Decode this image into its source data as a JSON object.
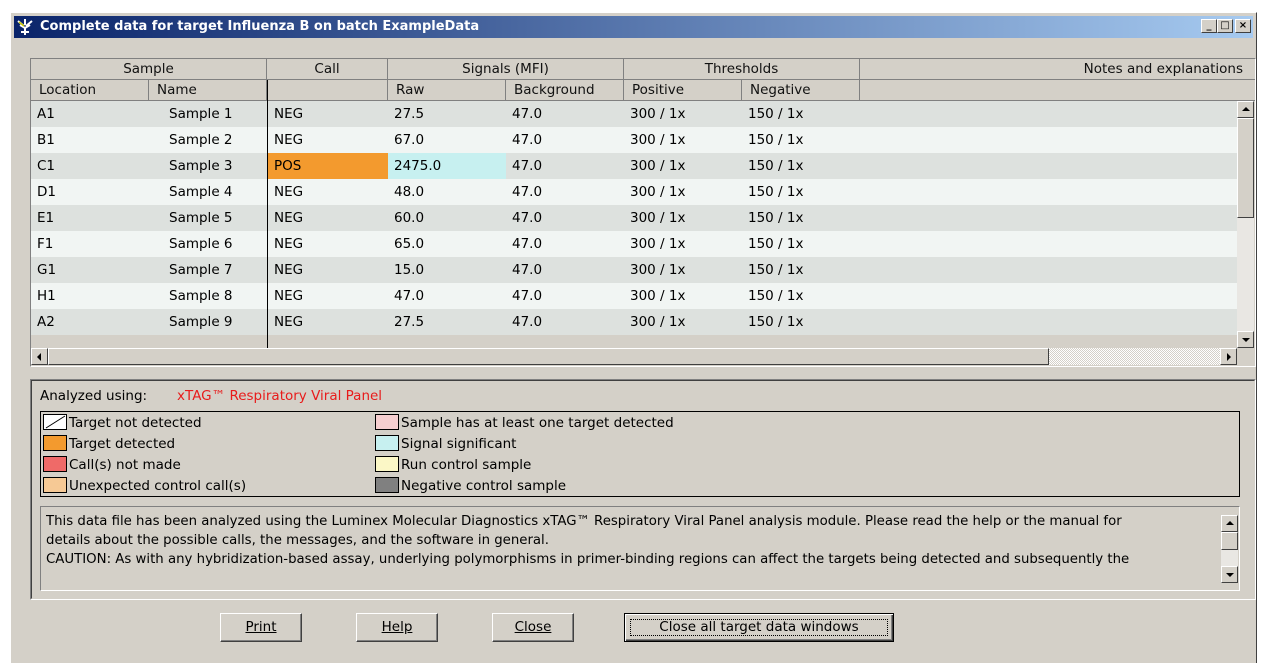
{
  "window": {
    "title": "Complete data for target Influenza B on batch ExampleData",
    "controls": {
      "minimize": "_",
      "maximize": "□",
      "close": "×"
    }
  },
  "table": {
    "groups": [
      "Sample",
      "Call",
      "Signals (MFI)",
      "Thresholds",
      "Notes and explanations"
    ],
    "columns": [
      "Location",
      "Name",
      "",
      "Raw",
      "Background",
      "Positive",
      "Negative"
    ],
    "rows": [
      {
        "location": "A1",
        "name": "Sample 1",
        "call": "NEG",
        "raw": "27.5",
        "background": "47.0",
        "positive": "300 / 1x",
        "negative": "150 / 1x"
      },
      {
        "location": "B1",
        "name": "Sample 2",
        "call": "NEG",
        "raw": "67.0",
        "background": "47.0",
        "positive": "300 / 1x",
        "negative": "150 / 1x"
      },
      {
        "location": "C1",
        "name": "Sample 3",
        "call": "POS",
        "raw": "2475.0",
        "background": "47.0",
        "positive": "300 / 1x",
        "negative": "150 / 1x"
      },
      {
        "location": "D1",
        "name": "Sample 4",
        "call": "NEG",
        "raw": "48.0",
        "background": "47.0",
        "positive": "300 / 1x",
        "negative": "150 / 1x"
      },
      {
        "location": "E1",
        "name": "Sample 5",
        "call": "NEG",
        "raw": "60.0",
        "background": "47.0",
        "positive": "300 / 1x",
        "negative": "150 / 1x"
      },
      {
        "location": "F1",
        "name": "Sample 6",
        "call": "NEG",
        "raw": "65.0",
        "background": "47.0",
        "positive": "300 / 1x",
        "negative": "150 / 1x"
      },
      {
        "location": "G1",
        "name": "Sample 7",
        "call": "NEG",
        "raw": "15.0",
        "background": "47.0",
        "positive": "300 / 1x",
        "negative": "150 / 1x"
      },
      {
        "location": "H1",
        "name": "Sample 8",
        "call": "NEG",
        "raw": "47.0",
        "background": "47.0",
        "positive": "300 / 1x",
        "negative": "150 / 1x"
      },
      {
        "location": "A2",
        "name": "Sample 9",
        "call": "NEG",
        "raw": "27.5",
        "background": "47.0",
        "positive": "300 / 1x",
        "negative": "150 / 1x"
      }
    ]
  },
  "legend": {
    "analyzed_label": "Analyzed using:",
    "analyzed_value": "xTAG™ Respiratory Viral Panel",
    "items": [
      {
        "label": "Target not detected",
        "color": "#ffffff",
        "icon": "diagonal-line"
      },
      {
        "label": "Target detected",
        "color": "#f39a2e"
      },
      {
        "label": "Call(s) not made",
        "color": "#ef6a68"
      },
      {
        "label": "Unexpected control call(s)",
        "color": "#f6c995"
      },
      {
        "label": "Sample has at least one target detected",
        "color": "#f6cfd0"
      },
      {
        "label": "Signal significant",
        "color": "#c7f0f0"
      },
      {
        "label": "Run control sample",
        "color": "#fbf7c6"
      },
      {
        "label": "Negative control sample",
        "color": "#808080"
      }
    ]
  },
  "notes": {
    "line1": "This data file has been analyzed using the Luminex Molecular Diagnostics xTAG™ Respiratory Viral Panel analysis module. Please read the help or the manual for",
    "line2": "details about the possible calls, the messages, and the software in general.",
    "line3": "CAUTION:  As with any hybridization-based assay, underlying polymorphisms in primer-binding regions can affect the targets being detected and subsequently the"
  },
  "buttons": {
    "print": "Print",
    "help": "Help",
    "close": "Close",
    "close_all": "Close all target data windows"
  },
  "colors": {
    "pos_call": "#f39a2e",
    "signal_significant": "#c7f0f0",
    "row_even": "#dde1de",
    "row_odd": "#f1f5f3",
    "analyzed_value": "#e81b1b"
  }
}
